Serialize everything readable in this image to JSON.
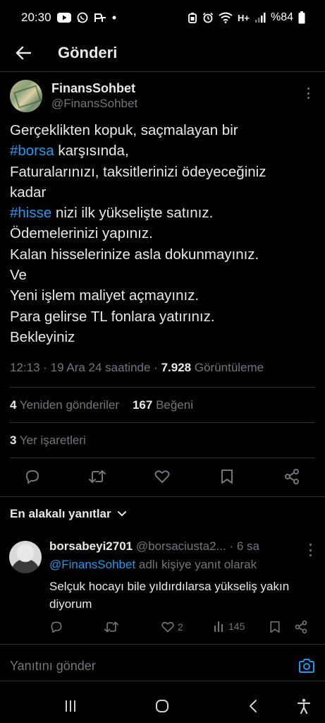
{
  "status": {
    "time": "20:30",
    "network": "H+",
    "battery": "%84"
  },
  "header": {
    "title": "Gönderi"
  },
  "post": {
    "author_name": "FinansSohbet",
    "author_handle": "@FinansSohbet",
    "lines": [
      {
        "pre": "Gerçeklikten kopuk, saçmalayan bir",
        "tag": "",
        "post": ""
      },
      {
        "pre": "",
        "tag": "#borsa",
        "post": " karşısında,"
      },
      {
        "pre": "Faturalarınızı, taksitlerinizi ödeyeceğiniz",
        "tag": "",
        "post": ""
      },
      {
        "pre": "kadar",
        "tag": "",
        "post": ""
      },
      {
        "pre": "",
        "tag": "#hisse",
        "post": " nizi ilk yükselişte satınız."
      },
      {
        "pre": "Ödemelerinizi yapınız.",
        "tag": "",
        "post": ""
      },
      {
        "pre": "Kalan hisselerinize asla dokunmayınız.",
        "tag": "",
        "post": ""
      },
      {
        "pre": "Ve",
        "tag": "",
        "post": ""
      },
      {
        "pre": "Yeni işlem maliyet açmayınız.",
        "tag": "",
        "post": ""
      },
      {
        "pre": "Para gelirse TL fonlara yatırınız.",
        "tag": "",
        "post": ""
      },
      {
        "pre": "Bekleyiniz",
        "tag": "",
        "post": ""
      }
    ],
    "time": "12:13",
    "date": "19 Ara 24 saatinde",
    "views_count": "7.928",
    "views_label": "Görüntüleme",
    "reposts_count": "4",
    "reposts_label": "Yeniden gönderiler",
    "likes_count": "167",
    "likes_label": "Beğeni",
    "bookmarks_count": "3",
    "bookmarks_label": "Yer işaretleri"
  },
  "replies_section": {
    "sort_label": "En alakalı yanıtlar"
  },
  "reply": {
    "name": "borsabeyi2701",
    "handle": "@borsaciusta2...",
    "age": "6 sa",
    "reply_to_mention": "@FinansSohbet",
    "reply_to_suffix": " adlı kişiye yanıt olarak",
    "text": "Selçuk hocayı bile yıldırdılarsa yükseliş yakın diyorum",
    "like_count": "2",
    "view_count": "145"
  },
  "compose": {
    "placeholder": "Yanıtını gönder"
  }
}
